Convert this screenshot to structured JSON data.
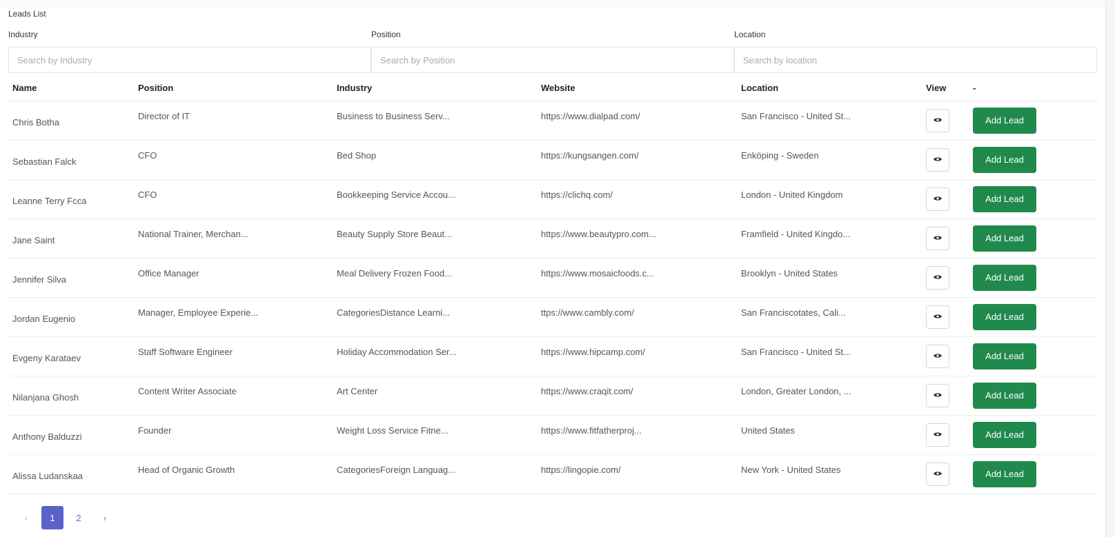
{
  "header": {
    "title": "",
    "section_label": "Leads List"
  },
  "filters": [
    {
      "label": "Industry",
      "placeholder": "Search by Industry",
      "value": ""
    },
    {
      "label": "Position",
      "placeholder": "Search by Position",
      "value": ""
    },
    {
      "label": "Location",
      "placeholder": "Search by location",
      "value": ""
    }
  ],
  "table": {
    "columns": [
      "Name",
      "Position",
      "Industry",
      "Website",
      "Location",
      "View",
      "-"
    ],
    "add_label": "Add Lead",
    "rows": [
      {
        "name": "Chris Botha",
        "position": "Director of IT",
        "industry": "Business to Business Serv...",
        "website": "https://www.dialpad.com/",
        "location": "San Francisco - United St..."
      },
      {
        "name": "Sebastian Falck",
        "position": "CFO",
        "industry": "Bed Shop",
        "website": "https://kungsangen.com/",
        "location": "Enköping - Sweden"
      },
      {
        "name": "Leanne Terry Fcca",
        "position": "CFO",
        "industry": "Bookkeeping Service Accou...",
        "website": "https://clichq.com/",
        "location": "London - United Kingdom"
      },
      {
        "name": "Jane Saint",
        "position": "National Trainer, Merchan...",
        "industry": "Beauty Supply Store Beaut...",
        "website": "https://www.beautypro.com...",
        "location": "Framfield - United Kingdo..."
      },
      {
        "name": "Jennifer Silva",
        "position": "Office Manager",
        "industry": "Meal Delivery Frozen Food...",
        "website": "https://www.mosaicfoods.c...",
        "location": "Brooklyn - United States"
      },
      {
        "name": "Jordan Eugenio",
        "position": "Manager, Employee Experie...",
        "industry": "CategoriesDistance Learni...",
        "website": "ttps://www.cambly.com/",
        "location": "San Franciscotates, Cali..."
      },
      {
        "name": "Evgeny Karataev",
        "position": "Staff Software Engineer",
        "industry": "Holiday Accommodation Ser...",
        "website": "https://www.hipcamp.com/",
        "location": "San Francisco - United St..."
      },
      {
        "name": "Nilanjana Ghosh",
        "position": "Content Writer Associate",
        "industry": "Art Center",
        "website": "https://www.craqit.com/",
        "location": "London, Greater London, ..."
      },
      {
        "name": "Anthony Balduzzi",
        "position": "Founder",
        "industry": "Weight Loss Service Fitne...",
        "website": "https://www.fitfatherproj...",
        "location": "United States"
      },
      {
        "name": "Alissa Ludanskaa",
        "position": "Head of Organic Growth",
        "industry": "CategoriesForeign Languag...",
        "website": "https://lingopie.com/",
        "location": "New York - United States"
      }
    ]
  },
  "pagination": {
    "prev": "‹",
    "pages": [
      "1",
      "2"
    ],
    "active": "1",
    "next": "›"
  },
  "colors": {
    "add_button": "#1f8a4c",
    "active_page": "#5a62c8",
    "link": "#5b6bd6"
  },
  "icons": {
    "view": "eye-icon"
  }
}
